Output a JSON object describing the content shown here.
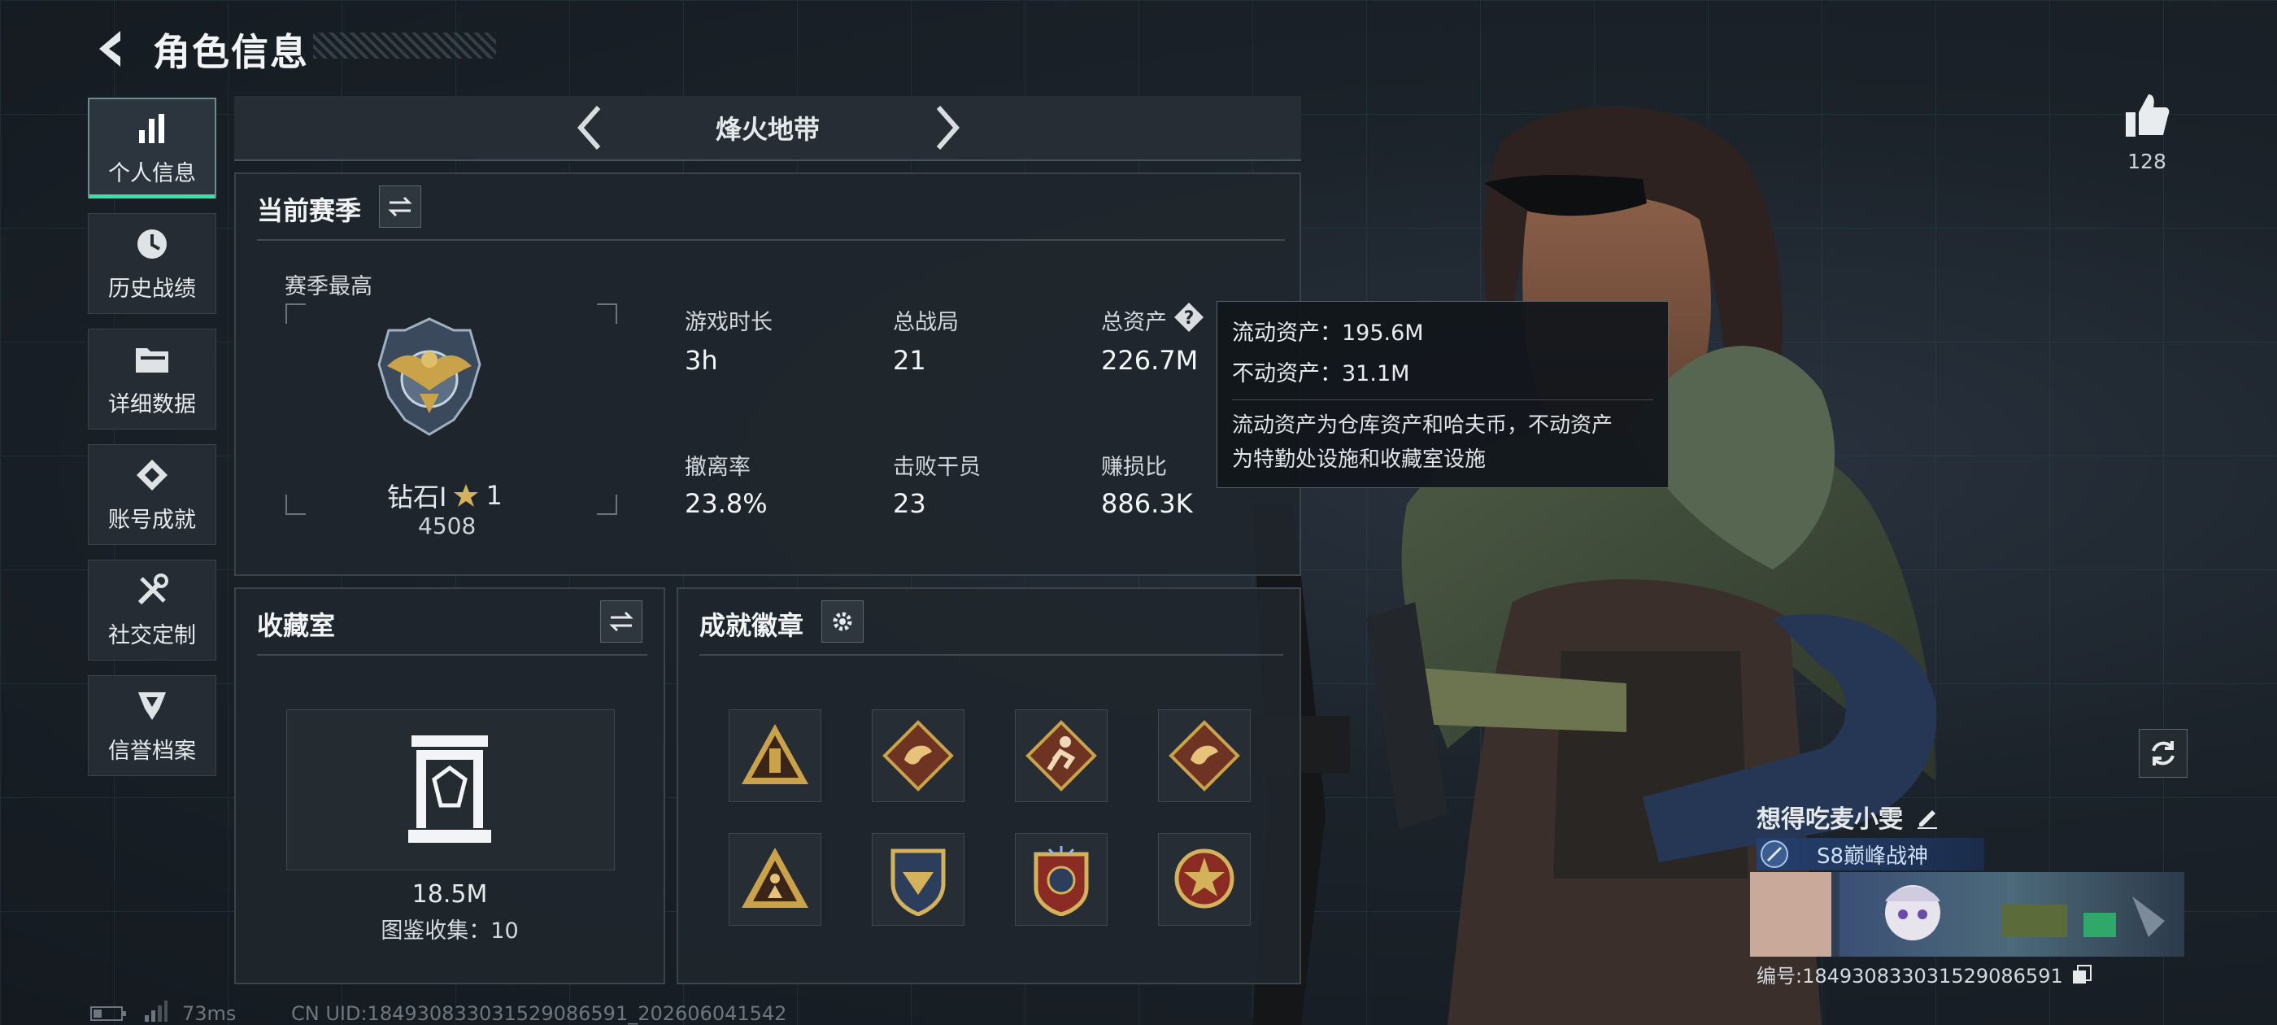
{
  "header": {
    "title": "角色信息"
  },
  "sidebar": {
    "items": [
      {
        "label": "个人信息",
        "icon": "bar-chart-icon",
        "active": true
      },
      {
        "label": "历史战绩",
        "icon": "clock-icon",
        "active": false
      },
      {
        "label": "详细数据",
        "icon": "folder-icon",
        "active": false
      },
      {
        "label": "账号成就",
        "icon": "achievement-icon",
        "active": false
      },
      {
        "label": "社交定制",
        "icon": "tools-icon",
        "active": false
      },
      {
        "label": "信誉档案",
        "icon": "shield-icon",
        "active": false
      }
    ]
  },
  "mode": {
    "title": "烽火地带"
  },
  "season": {
    "title": "当前赛季",
    "best_label": "赛季最高",
    "rank_name": "钻石I",
    "rank_stars": "1",
    "rank_score": "4508",
    "stats": [
      {
        "label": "游戏时长",
        "value": "3h"
      },
      {
        "label": "总战局",
        "value": "21"
      },
      {
        "label": "总资产",
        "value": "226.7M"
      },
      {
        "label": "撤离率",
        "value": "23.8%"
      },
      {
        "label": "击败干员",
        "value": "23"
      },
      {
        "label": "赚损比",
        "value": "886.3K"
      }
    ]
  },
  "tooltip": {
    "liquid": "流动资产：195.6M",
    "fixed": "不动资产：31.1M",
    "desc_line1": "流动资产为仓库资产和哈夫币，不动资产",
    "desc_line2": "为特勤处设施和收藏室设施"
  },
  "collection": {
    "title": "收藏室",
    "value": "18.5M",
    "catalog": "图鉴收集：10"
  },
  "badges": {
    "title": "成就徽章",
    "items": [
      "badge-supply",
      "badge-dragon",
      "badge-runner",
      "badge-dragon-2",
      "badge-soldier",
      "badge-emblem",
      "badge-star",
      "badge-medal"
    ]
  },
  "profile": {
    "likes": "128",
    "name": "想得吃麦小雯",
    "title_badge": "S8巅峰战神",
    "id_text": "编号:18493083303152908659​1"
  },
  "footer": {
    "ping": "73ms",
    "uid": "CN UID:18493083303152908659​1_202606041542"
  },
  "colors": {
    "accent": "#3be0a6",
    "gold": "#c9a24a",
    "bg": "#1a2026"
  }
}
